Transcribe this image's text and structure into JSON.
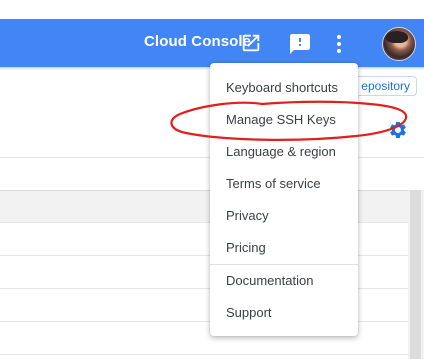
{
  "header": {
    "console_link": "Cloud Console",
    "icons": [
      "open-in-new-icon",
      "feedback-icon",
      "more-vert-icon",
      "avatar"
    ]
  },
  "background": {
    "repo_button": "epository",
    "icons": [
      "settings-gear-icon"
    ]
  },
  "menu": {
    "items": [
      {
        "label": "Keyboard shortcuts"
      },
      {
        "label": "Manage SSH Keys"
      },
      {
        "label": "Language & region"
      },
      {
        "label": "Terms of service"
      },
      {
        "label": "Privacy"
      },
      {
        "label": "Pricing"
      },
      {
        "label": "Documentation"
      },
      {
        "label": "Support"
      }
    ]
  },
  "colors": {
    "header_blue": "#4285f4",
    "link_blue": "#1a73e8",
    "annotation_red": "#e0201a",
    "menu_text": "#3c4043"
  }
}
